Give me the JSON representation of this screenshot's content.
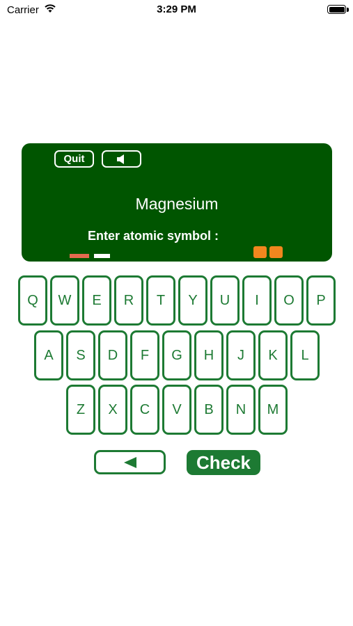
{
  "status_bar": {
    "carrier": "Carrier",
    "time": "3:29 PM"
  },
  "board": {
    "quit_label": "Quit",
    "element_name": "Magnesium",
    "prompt": "Enter atomic symbol :",
    "answer_slots": 2
  },
  "keyboard": {
    "row1": [
      "Q",
      "W",
      "E",
      "R",
      "T",
      "Y",
      "U",
      "I",
      "O",
      "P"
    ],
    "row2": [
      "A",
      "S",
      "D",
      "F",
      "G",
      "H",
      "J",
      "K",
      "L"
    ],
    "row3": [
      "Z",
      "X",
      "C",
      "V",
      "B",
      "N",
      "M"
    ]
  },
  "actions": {
    "check_label": "Check"
  },
  "colors": {
    "board": "#005500",
    "key_border": "#1d7a33",
    "slot": "#f0871e",
    "progress_done": "#e26a4f"
  }
}
